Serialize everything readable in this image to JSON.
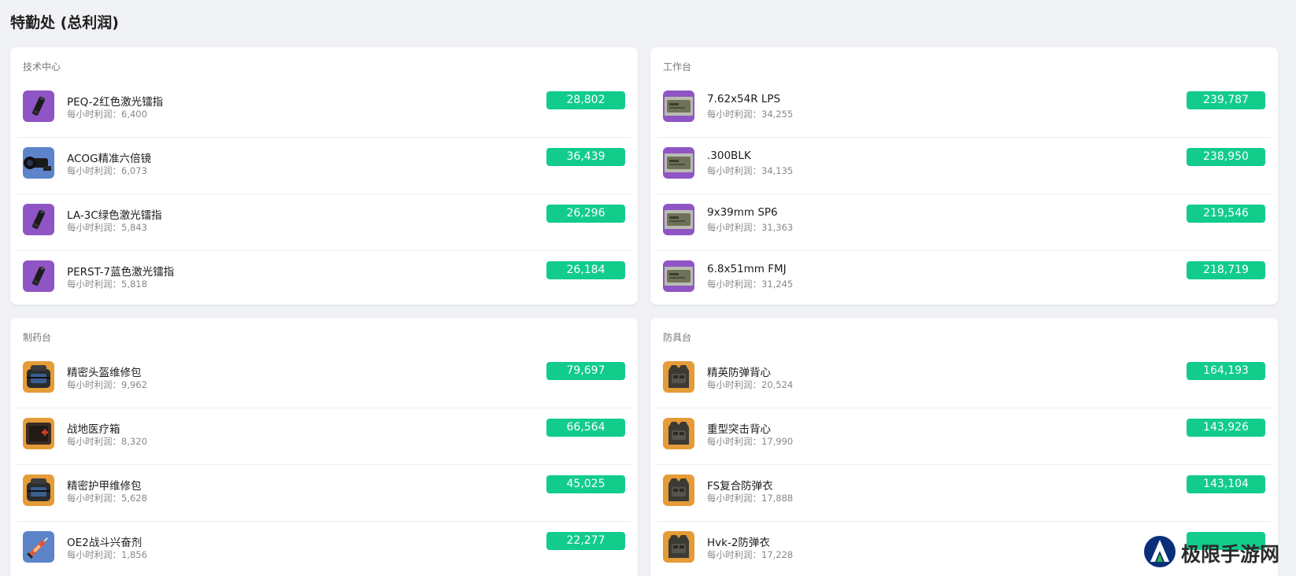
{
  "page": {
    "title": "特勤处 (总利润)"
  },
  "sub_prefix": "每小时利润：",
  "sections": [
    {
      "title": "技术中心",
      "items": [
        {
          "name": "PEQ-2红色激光镭指",
          "hourly": "6,400",
          "total": "28,802",
          "icon": "laser-module-icon",
          "bg": "purple"
        },
        {
          "name": "ACOG精准六倍镜",
          "hourly": "6,073",
          "total": "36,439",
          "icon": "scope-icon",
          "bg": "blue"
        },
        {
          "name": "LA-3C绿色激光镭指",
          "hourly": "5,843",
          "total": "26,296",
          "icon": "laser-module-icon",
          "bg": "purple"
        },
        {
          "name": "PERST-7蓝色激光镭指",
          "hourly": "5,818",
          "total": "26,184",
          "icon": "laser-module-icon",
          "bg": "purple"
        }
      ]
    },
    {
      "title": "工作台",
      "items": [
        {
          "name": "7.62x54R LPS",
          "hourly": "34,255",
          "total": "239,787",
          "icon": "ammo-box-icon",
          "bg": "purple"
        },
        {
          "name": ".300BLK",
          "hourly": "34,135",
          "total": "238,950",
          "icon": "ammo-box-icon",
          "bg": "purple"
        },
        {
          "name": "9x39mm SP6",
          "hourly": "31,363",
          "total": "219,546",
          "icon": "ammo-box-icon",
          "bg": "purple"
        },
        {
          "name": "6.8x51mm FMJ",
          "hourly": "31,245",
          "total": "218,719",
          "icon": "ammo-box-icon",
          "bg": "purple"
        }
      ]
    },
    {
      "title": "制药台",
      "items": [
        {
          "name": "精密头盔维修包",
          "hourly": "9,962",
          "total": "79,697",
          "icon": "repair-kit-icon",
          "bg": "orange"
        },
        {
          "name": "战地医疗箱",
          "hourly": "8,320",
          "total": "66,564",
          "icon": "medical-kit-icon",
          "bg": "orange"
        },
        {
          "name": "精密护甲维修包",
          "hourly": "5,628",
          "total": "45,025",
          "icon": "repair-kit-icon",
          "bg": "orange"
        },
        {
          "name": "OE2战斗兴奋剂",
          "hourly": "1,856",
          "total": "22,277",
          "icon": "stimulant-syringe-icon",
          "bg": "blue"
        }
      ]
    },
    {
      "title": "防具台",
      "items": [
        {
          "name": "精英防弹背心",
          "hourly": "20,524",
          "total": "164,193",
          "icon": "body-armor-icon",
          "bg": "orange"
        },
        {
          "name": "重型突击背心",
          "hourly": "17,990",
          "total": "143,926",
          "icon": "body-armor-icon",
          "bg": "orange"
        },
        {
          "name": "FS复合防弹衣",
          "hourly": "17,888",
          "total": "143,104",
          "icon": "body-armor-icon",
          "bg": "orange"
        },
        {
          "name": "Hvk-2防弹衣",
          "hourly": "17,228",
          "total": "",
          "icon": "body-armor-icon",
          "bg": "orange"
        }
      ]
    }
  ],
  "watermark": {
    "text": "极限手游网",
    "icon": "site-logo-icon"
  },
  "colors": {
    "badge": "#12cc8b",
    "purple": "#8f55c4",
    "blue": "#5d84c9",
    "orange": "#e59b37",
    "background": "#f1f2f5"
  }
}
